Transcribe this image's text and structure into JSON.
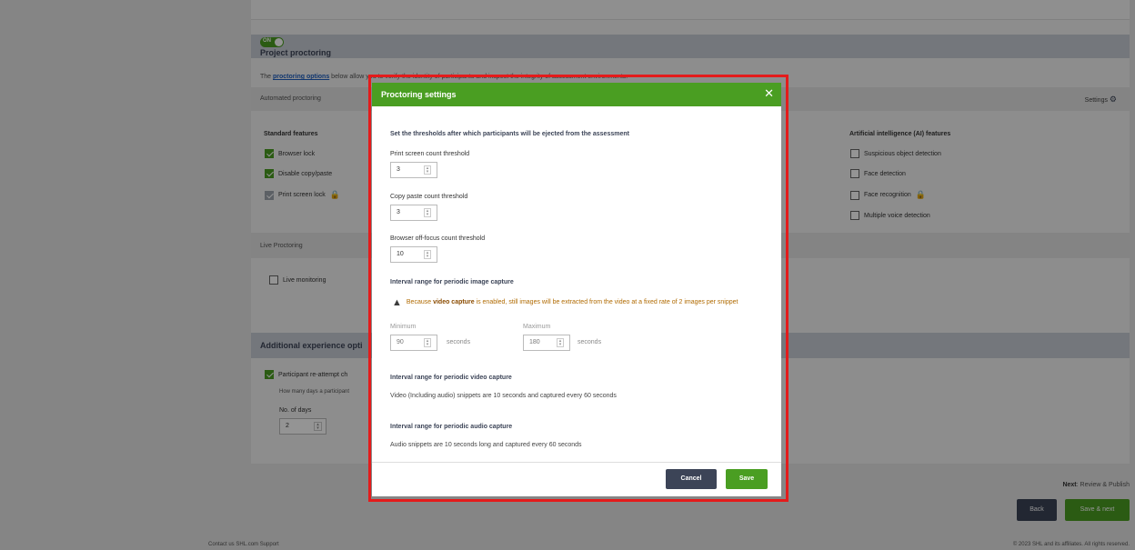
{
  "proctoring": {
    "toggle": "ON",
    "title": "Project proctoring",
    "intro_prefix": "The ",
    "intro_link": "proctoring options",
    "intro_suffix": " below allow you to verify the identity of participants and inspect the integrity of assessment environments.",
    "automated_label": "Automated proctoring",
    "settings_label": "Settings",
    "standard_heading": "Standard features",
    "standard_features": [
      {
        "label": "Browser lock",
        "checked": true
      },
      {
        "label": "Disable copy/paste",
        "checked": true
      },
      {
        "label": "Print screen lock",
        "checked": true
      }
    ],
    "ai_heading": "Artificial intelligence (AI) features",
    "ai_features": [
      {
        "label": "Suspicious object detection",
        "checked": false
      },
      {
        "label": "Face detection",
        "checked": false
      },
      {
        "label": "Face recognition",
        "checked": false
      },
      {
        "label": "Multiple voice detection",
        "checked": false
      }
    ],
    "live_label": "Live Proctoring",
    "live_monitoring": "Live monitoring"
  },
  "additional": {
    "title": "Additional experience opti",
    "reattempt": "Participant re-attempt ch",
    "how_many": "How many days a participant",
    "days_label": "No. of days",
    "days_value": "2"
  },
  "navigation": {
    "next_prefix": "Next",
    "next_value": ": Review & Publish",
    "back": "Back",
    "save_next": "Save & next"
  },
  "footer": {
    "links": "Contact us  SHL.com  Support",
    "copyright": "© 2023 SHL and its affiliates. All rights reserved."
  },
  "modal": {
    "title": "Proctoring settings",
    "close": "✕",
    "thresholds_heading": "Set the thresholds after which participants will be ejected from the assessment",
    "print_label": "Print screen count threshold",
    "print_value": "3",
    "copy_label": "Copy paste count threshold",
    "copy_value": "3",
    "focus_label": "Browser off-focus count threshold",
    "focus_value": "10",
    "image_heading": "Interval range for periodic image capture",
    "warning_prefix": "Because ",
    "warning_bold": "video capture",
    "warning_suffix": " is enabled, still images will be extracted from the video at a fixed rate of 2 images per snippet",
    "min_label": "Minimum",
    "min_value": "90",
    "max_label": "Maximum",
    "max_value": "180",
    "unit_label": "seconds",
    "video_heading": "Interval range for periodic video capture",
    "video_note": "Video (Including audio) snippets are 10 seconds and captured every 60 seconds",
    "audio_heading": "Interval range for periodic audio capture",
    "audio_note": "Audio snippets are 10 seconds long and captured every 60 seconds",
    "cancel": "Cancel",
    "save": "Save"
  },
  "colors": {
    "brand_green": "#4a9e22",
    "dark_navy": "#3c4457",
    "highlight_red": "#e41b1b"
  }
}
